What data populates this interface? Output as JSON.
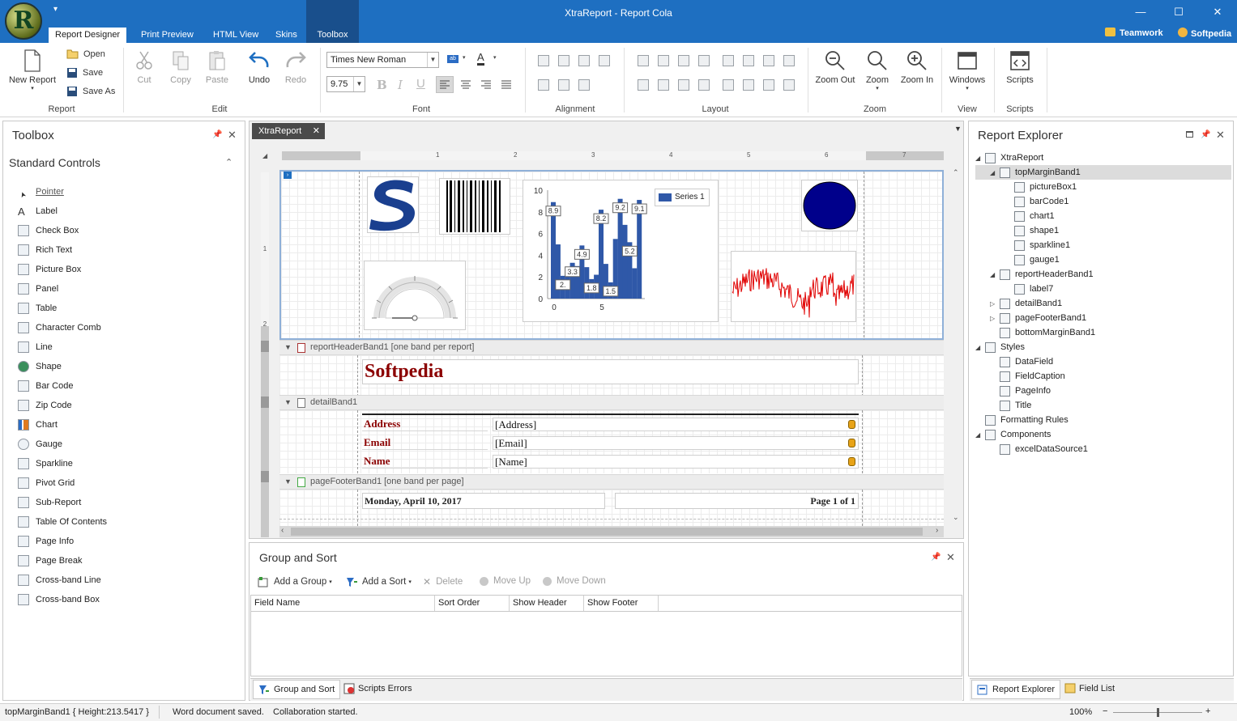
{
  "window": {
    "title": "XtraReport - Report Cola",
    "logo_letter": "R",
    "quick_access": "▾",
    "controls": {
      "minimize": "—",
      "maximize": "☐",
      "close": "✕"
    },
    "user_links": [
      "Teamwork",
      "Softpedia"
    ]
  },
  "menu_tabs": [
    {
      "label": "Report Designer",
      "active": true
    },
    {
      "label": "Print Preview"
    },
    {
      "label": "HTML View"
    },
    {
      "label": "Skins"
    },
    {
      "label": "Toolbox"
    }
  ],
  "ribbon": {
    "report": {
      "label": "Report",
      "new_report": "New Report",
      "open": "Open",
      "save": "Save",
      "save_as": "Save As"
    },
    "edit": {
      "label": "Edit",
      "cut": "Cut",
      "copy": "Copy",
      "paste": "Paste",
      "undo": "Undo",
      "redo": "Redo"
    },
    "font": {
      "label": "Font",
      "family": "Times New Roman",
      "size": "9.75"
    },
    "alignment": {
      "label": "Alignment"
    },
    "layout": {
      "label": "Layout"
    },
    "zoom": {
      "label": "Zoom",
      "zoom_out": "Zoom Out",
      "zoom": "Zoom",
      "zoom_in": "Zoom In"
    },
    "view": {
      "label": "View",
      "windows": "Windows"
    },
    "scripts": {
      "label": "Scripts",
      "scripts": "Scripts"
    }
  },
  "toolbox": {
    "title": "Toolbox",
    "section": "Standard Controls",
    "items": [
      {
        "label": "Pointer",
        "icon": "pointer-icon"
      },
      {
        "label": "Label",
        "icon": "label-icon"
      },
      {
        "label": "Check Box",
        "icon": "checkbox-icon"
      },
      {
        "label": "Rich Text",
        "icon": "richtext-icon"
      },
      {
        "label": "Picture Box",
        "icon": "picture-icon"
      },
      {
        "label": "Panel",
        "icon": "panel-icon"
      },
      {
        "label": "Table",
        "icon": "table-icon"
      },
      {
        "label": "Character Comb",
        "icon": "charcomb-icon"
      },
      {
        "label": "Line",
        "icon": "line-icon"
      },
      {
        "label": "Shape",
        "icon": "shape-icon"
      },
      {
        "label": "Bar Code",
        "icon": "barcode-icon"
      },
      {
        "label": "Zip Code",
        "icon": "zipcode-icon"
      },
      {
        "label": "Chart",
        "icon": "chart-icon"
      },
      {
        "label": "Gauge",
        "icon": "gauge-icon"
      },
      {
        "label": "Sparkline",
        "icon": "sparkline-icon"
      },
      {
        "label": "Pivot Grid",
        "icon": "pivot-icon"
      },
      {
        "label": "Sub-Report",
        "icon": "subreport-icon"
      },
      {
        "label": "Table Of Contents",
        "icon": "toc-icon"
      },
      {
        "label": "Page Info",
        "icon": "pageinfo-icon"
      },
      {
        "label": "Page Break",
        "icon": "pagebreak-icon"
      },
      {
        "label": "Cross-band Line",
        "icon": "crossline-icon"
      },
      {
        "label": "Cross-band Box",
        "icon": "crossbox-icon"
      }
    ]
  },
  "designer": {
    "doc_tab": "XtraReport",
    "ruler_marks": [
      "1",
      "2",
      "3",
      "4",
      "5",
      "6",
      "7"
    ],
    "vruler_marks": [
      "1",
      "2"
    ],
    "header_band": "reportHeaderBand1 [one band per report]",
    "header_label": "Softpedia",
    "detail_band": "detailBand1",
    "fields": [
      {
        "caption": "Address",
        "value": "[Address]"
      },
      {
        "caption": "Email",
        "value": "[Email]"
      },
      {
        "caption": "Name",
        "value": "[Name]"
      }
    ],
    "footer_band": "pageFooterBand1 [one band per page]",
    "footer_date": "Monday, April 10, 2017",
    "footer_page": "Page 1 of 1",
    "colors": {
      "caption": "#8b0000",
      "accent": "#1e6fc1",
      "chart_bar": "#2f58a8",
      "shape_fill": "#00008b",
      "sparkline": "#e00000"
    }
  },
  "chart_data": {
    "type": "bar",
    "x": [
      0,
      1,
      2,
      3,
      4,
      5,
      6,
      7,
      8
    ],
    "series": [
      {
        "name": "Series 1",
        "values": [
          8.9,
          2.1,
          3.3,
          4.9,
          1.8,
          8.2,
          1.5,
          9.2,
          5.2,
          9.1
        ]
      }
    ],
    "bars": [
      {
        "x": 0,
        "y": 8.9,
        "label": "8.9"
      },
      {
        "x": 1,
        "y": 2.1,
        "label": "2."
      },
      {
        "x": 2,
        "y": 3.3,
        "label": "3.3"
      },
      {
        "x": 3,
        "y": 4.9,
        "label": "4.9"
      },
      {
        "x": 4,
        "y": 1.8,
        "label": "1.8"
      },
      {
        "x": 5,
        "y": 8.2,
        "label": "8.2"
      },
      {
        "x": 6,
        "y": 1.5,
        "label": "1.5"
      },
      {
        "x": 7,
        "y": 9.2,
        "label": "9.2"
      },
      {
        "x": 8,
        "y": 5.2,
        "label": "5.2"
      },
      {
        "x": 9,
        "y": 9.1,
        "label": "9.1"
      }
    ],
    "extra_bars": [
      {
        "x": 0.5,
        "y": 5.0
      },
      {
        "x": 1.5,
        "y": 2.6
      },
      {
        "x": 2.5,
        "y": 3.0
      },
      {
        "x": 3.5,
        "y": 2.9
      },
      {
        "x": 4.5,
        "y": 2.2
      },
      {
        "x": 5.5,
        "y": 3.2
      },
      {
        "x": 6.5,
        "y": 5.5
      },
      {
        "x": 7.5,
        "y": 6.8
      },
      {
        "x": 8.5,
        "y": 2.8
      }
    ],
    "yticks": [
      "0",
      "2",
      "4",
      "6",
      "8",
      "10"
    ],
    "xticks": [
      "0",
      "5"
    ],
    "ylim": [
      0,
      10
    ],
    "legend": "top-right"
  },
  "group_sort": {
    "title": "Group and Sort",
    "tools": {
      "add_group": "Add a Group",
      "add_sort": "Add a Sort",
      "delete": "Delete",
      "move_up": "Move Up",
      "move_down": "Move Down"
    },
    "columns": [
      "Field Name",
      "Sort Order",
      "Show Header",
      "Show Footer"
    ],
    "tabs": {
      "group_sort": "Group and Sort",
      "scripts_errors": "Scripts Errors"
    }
  },
  "explorer": {
    "title": "Report Explorer",
    "tree": [
      {
        "label": "XtraReport",
        "level": 0,
        "exp": "◢"
      },
      {
        "label": "topMarginBand1",
        "level": 1,
        "exp": "◢",
        "selected": true
      },
      {
        "label": "pictureBox1",
        "level": 2
      },
      {
        "label": "barCode1",
        "level": 2
      },
      {
        "label": "chart1",
        "level": 2
      },
      {
        "label": "shape1",
        "level": 2
      },
      {
        "label": "sparkline1",
        "level": 2
      },
      {
        "label": "gauge1",
        "level": 2
      },
      {
        "label": "reportHeaderBand1",
        "level": 1,
        "exp": "◢"
      },
      {
        "label": "label7",
        "level": 2
      },
      {
        "label": "detailBand1",
        "level": 1,
        "exp": "▷"
      },
      {
        "label": "pageFooterBand1",
        "level": 1,
        "exp": "▷"
      },
      {
        "label": "bottomMarginBand1",
        "level": 1
      },
      {
        "label": "Styles",
        "level": 0,
        "exp": "◢"
      },
      {
        "label": "DataField",
        "level": 1
      },
      {
        "label": "FieldCaption",
        "level": 1
      },
      {
        "label": "PageInfo",
        "level": 1
      },
      {
        "label": "Title",
        "level": 1
      },
      {
        "label": "Formatting Rules",
        "level": 0
      },
      {
        "label": "Components",
        "level": 0,
        "exp": "◢"
      },
      {
        "label": "excelDataSource1",
        "level": 1
      }
    ],
    "tabs": {
      "explorer": "Report Explorer",
      "field_list": "Field List"
    }
  },
  "status": {
    "selection": "topMarginBand1 { Height:213.5417 }",
    "message1": "Word document saved.",
    "message2": "Collaboration started.",
    "zoom": "100%",
    "zoom_minus": "−",
    "zoom_plus": "+",
    "zoom_level": 0.5
  }
}
